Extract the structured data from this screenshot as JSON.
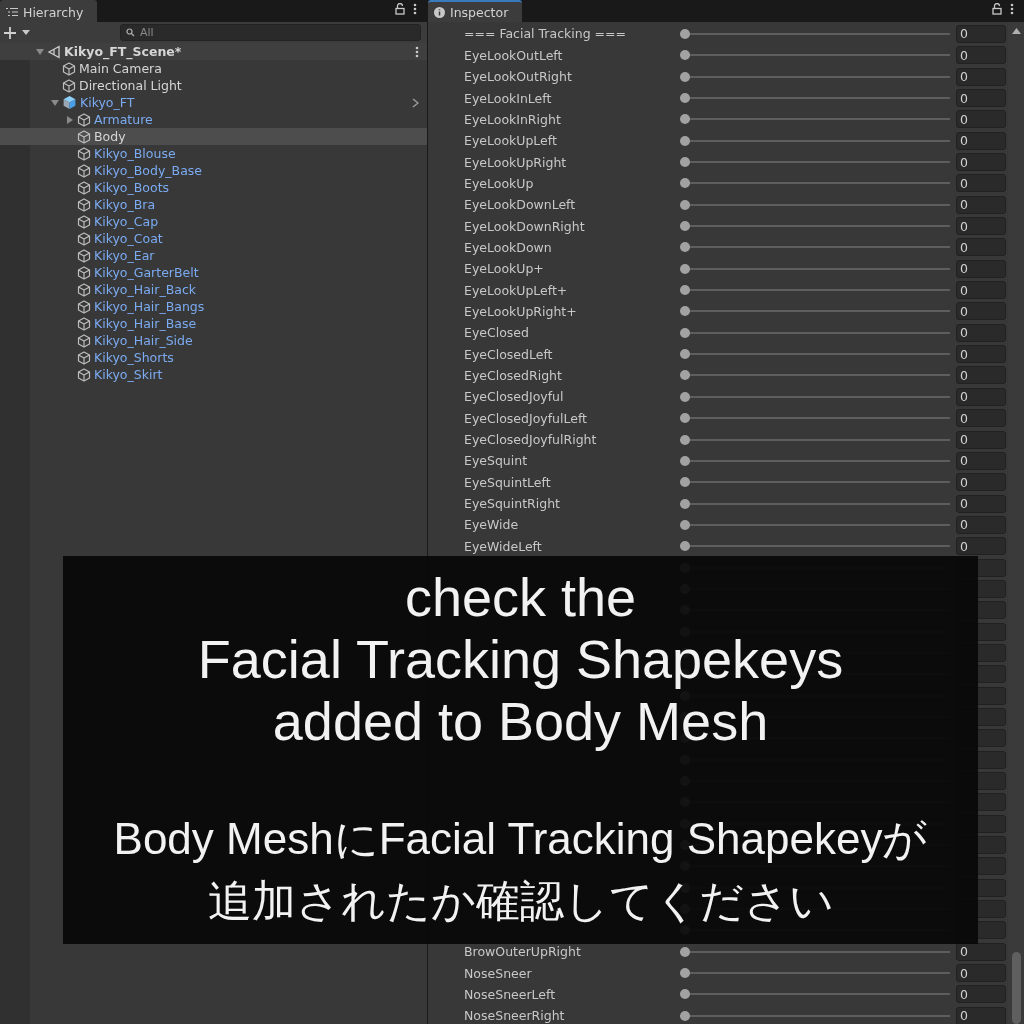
{
  "hierarchy": {
    "tab": {
      "label": "Hierarchy",
      "focused": false
    },
    "search": {
      "placeholder": "All"
    },
    "tree": [
      {
        "label": "Kikyo_FT_Scene*",
        "kind": "scene",
        "prefab": false,
        "selected": false,
        "expanded": true,
        "children": [
          {
            "label": "Main Camera",
            "kind": "gameobject",
            "prefab": false,
            "selected": false
          },
          {
            "label": "Directional Light",
            "kind": "gameobject",
            "prefab": false,
            "selected": false
          },
          {
            "label": "Kikyo_FT",
            "kind": "prefab_root",
            "prefab": true,
            "selected": false,
            "expanded": true,
            "children": [
              {
                "label": "Armature",
                "kind": "gameobject",
                "prefab": true,
                "selected": false,
                "expanded": false
              },
              {
                "label": "Body",
                "kind": "gameobject",
                "prefab": false,
                "selected": true
              },
              {
                "label": "Kikyo_Blouse",
                "kind": "gameobject",
                "prefab": true,
                "selected": false
              },
              {
                "label": "Kikyo_Body_Base",
                "kind": "gameobject",
                "prefab": true,
                "selected": false
              },
              {
                "label": "Kikyo_Boots",
                "kind": "gameobject",
                "prefab": true,
                "selected": false
              },
              {
                "label": "Kikyo_Bra",
                "kind": "gameobject",
                "prefab": true,
                "selected": false
              },
              {
                "label": "Kikyo_Cap",
                "kind": "gameobject",
                "prefab": true,
                "selected": false
              },
              {
                "label": "Kikyo_Coat",
                "kind": "gameobject",
                "prefab": true,
                "selected": false
              },
              {
                "label": "Kikyo_Ear",
                "kind": "gameobject",
                "prefab": true,
                "selected": false
              },
              {
                "label": "Kikyo_GarterBelt",
                "kind": "gameobject",
                "prefab": true,
                "selected": false
              },
              {
                "label": "Kikyo_Hair_Back",
                "kind": "gameobject",
                "prefab": true,
                "selected": false
              },
              {
                "label": "Kikyo_Hair_Bangs",
                "kind": "gameobject",
                "prefab": true,
                "selected": false
              },
              {
                "label": "Kikyo_Hair_Base",
                "kind": "gameobject",
                "prefab": true,
                "selected": false
              },
              {
                "label": "Kikyo_Hair_Side",
                "kind": "gameobject",
                "prefab": true,
                "selected": false
              },
              {
                "label": "Kikyo_Shorts",
                "kind": "gameobject",
                "prefab": true,
                "selected": false
              },
              {
                "label": "Kikyo_Skirt",
                "kind": "gameobject",
                "prefab": true,
                "selected": false
              }
            ]
          }
        ]
      }
    ]
  },
  "inspector": {
    "tab": {
      "label": "Inspector",
      "focused": true
    },
    "rows": [
      {
        "label": "=== Facial Tracking ===",
        "level": 0,
        "value": "0"
      },
      {
        "label": "EyeLookOutLeft",
        "level": 0,
        "value": "0"
      },
      {
        "label": "EyeLookOutRight",
        "level": 0,
        "value": "0"
      },
      {
        "label": "EyeLookInLeft",
        "level": 0,
        "value": "0"
      },
      {
        "label": "EyeLookInRight",
        "level": 0,
        "value": "0"
      },
      {
        "label": "EyeLookUpLeft",
        "level": 0,
        "value": "0"
      },
      {
        "label": "EyeLookUpRight",
        "level": 0,
        "value": "0"
      },
      {
        "label": "EyeLookUp",
        "level": 0,
        "value": "0"
      },
      {
        "label": "EyeLookDownLeft",
        "level": 0,
        "value": "0"
      },
      {
        "label": "EyeLookDownRight",
        "level": 0,
        "value": "0"
      },
      {
        "label": "EyeLookDown",
        "level": 0,
        "value": "0"
      },
      {
        "label": "EyeLookUp+",
        "level": 0,
        "value": "0"
      },
      {
        "label": "EyeLookUpLeft+",
        "level": 0,
        "value": "0"
      },
      {
        "label": "EyeLookUpRight+",
        "level": 0,
        "value": "0"
      },
      {
        "label": "EyeClosed",
        "level": 0,
        "value": "0"
      },
      {
        "label": "EyeClosedLeft",
        "level": 0,
        "value": "0"
      },
      {
        "label": "EyeClosedRight",
        "level": 0,
        "value": "0"
      },
      {
        "label": "EyeClosedJoyful",
        "level": 0,
        "value": "0"
      },
      {
        "label": "EyeClosedJoyfulLeft",
        "level": 0,
        "value": "0"
      },
      {
        "label": "EyeClosedJoyfulRight",
        "level": 0,
        "value": "0"
      },
      {
        "label": "EyeSquint",
        "level": 0,
        "value": "0"
      },
      {
        "label": "EyeSquintLeft",
        "level": 0,
        "value": "0"
      },
      {
        "label": "EyeSquintRight",
        "level": 0,
        "value": "0"
      },
      {
        "label": "EyeWide",
        "level": 0,
        "value": "0"
      },
      {
        "label": "EyeWideLeft",
        "level": 0,
        "value": "0"
      },
      {
        "level": 0
      },
      {
        "level": 0
      },
      {
        "level": 0
      },
      {
        "level": 0
      },
      {
        "level": 0
      },
      {
        "level": 0
      },
      {
        "level": 0
      },
      {
        "level": 0
      },
      {
        "level": 0
      },
      {
        "level": 0
      },
      {
        "level": 0
      },
      {
        "level": 0
      },
      {
        "level": 0
      },
      {
        "level": 0
      },
      {
        "level": 0
      },
      {
        "level": 0
      },
      {
        "level": 0
      },
      {
        "level": 0
      },
      {
        "label": "BrowOuterUpRight",
        "level": 0,
        "value": "0"
      },
      {
        "label": "NoseSneer",
        "level": 0,
        "value": "0"
      },
      {
        "label": "NoseSneerLeft",
        "level": 0,
        "value": "0"
      },
      {
        "label": "NoseSneerRight",
        "level": 0,
        "value": "0"
      }
    ]
  },
  "caption": {
    "title_lines": [
      "check the",
      "Facial Tracking Shapekeys",
      "added to Body Mesh"
    ],
    "subtitle_lines": [
      "Body MeshにFacial Tracking Shapekeyが",
      "追加されたか確認してください"
    ]
  }
}
